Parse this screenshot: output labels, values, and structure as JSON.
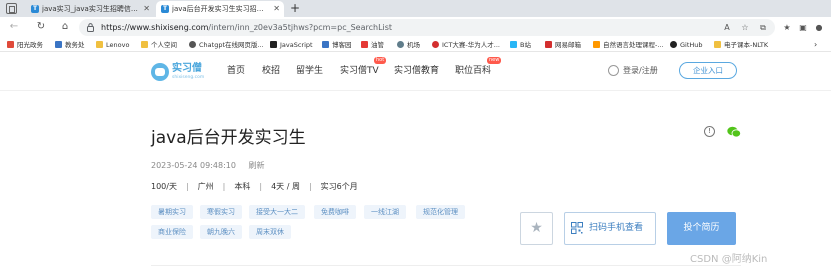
{
  "browser": {
    "tabs": [
      {
        "title": "java实习_java实习生招聘信息 - 实",
        "active": false
      },
      {
        "title": "java后台开发实习生实习招聘-实习",
        "active": true
      }
    ],
    "new_tab_label": "+",
    "url_host": "https://www.shixiseng.com",
    "url_path": "/intern/inn_z0ev3a5tjhws?pcm=pc_SearchList",
    "bookmarks": [
      {
        "label": "阳光政务",
        "color": "#e04a3a"
      },
      {
        "label": "教务处",
        "color": "#3a74c4"
      },
      {
        "label": "Lenovo",
        "color": "#f0c040"
      },
      {
        "label": "个人空间",
        "color": "#f0c040"
      },
      {
        "label": "Chatgpt在线网页版...",
        "color": "#555555"
      },
      {
        "label": "JavaScript",
        "color": "#222222"
      },
      {
        "label": "博客园",
        "color": "#3a74c4"
      },
      {
        "label": "油管",
        "color": "#e53935"
      },
      {
        "label": "机场",
        "color": "#607d8b"
      },
      {
        "label": "ICT大赛-华为人才...",
        "color": "#d32f2f"
      },
      {
        "label": "B站",
        "color": "#29b6f6"
      },
      {
        "label": "网易邮箱",
        "color": "#d32f2f"
      },
      {
        "label": "自然语言处理课程-...",
        "color": "#ff9800"
      },
      {
        "label": "GitHub",
        "color": "#222222"
      },
      {
        "label": "电子课本-NLTK",
        "color": "#f0c040"
      }
    ]
  },
  "site": {
    "logo_text": "实习僧",
    "logo_sub": "shixiseng.com",
    "nav": [
      {
        "label": "首页",
        "badge": ""
      },
      {
        "label": "校招",
        "badge": ""
      },
      {
        "label": "留学生",
        "badge": ""
      },
      {
        "label": "实习僧TV",
        "badge": "hot"
      },
      {
        "label": "实习僧教育",
        "badge": ""
      },
      {
        "label": "职位百科",
        "badge": "new"
      }
    ],
    "login_label": "登录/注册",
    "enterprise_label": "企业入口"
  },
  "job": {
    "title": "java后台开发实习生",
    "date": "2023-05-24 09:48:10",
    "refresh_label": "刷新",
    "specs": [
      "100/天",
      "广州",
      "本科",
      "4天 / 周",
      "实习6个月"
    ],
    "tags_row1": [
      "暑期实习",
      "寒假实习",
      "接受大一大二",
      "免费咖啡",
      "一线江湖",
      "规范化管理"
    ],
    "tags_row2": [
      "商业保险",
      "朝九晚六",
      "周末双休"
    ],
    "scan_label": "扫码手机查看",
    "apply_label": "投个简历"
  },
  "watermark": "CSDN @阿纳Kin",
  "colors": {
    "accent": "#6aa6e6",
    "tag_bg": "#eef4fb",
    "tag_text": "#5c8fc2",
    "badge": "#ff5a4c"
  }
}
